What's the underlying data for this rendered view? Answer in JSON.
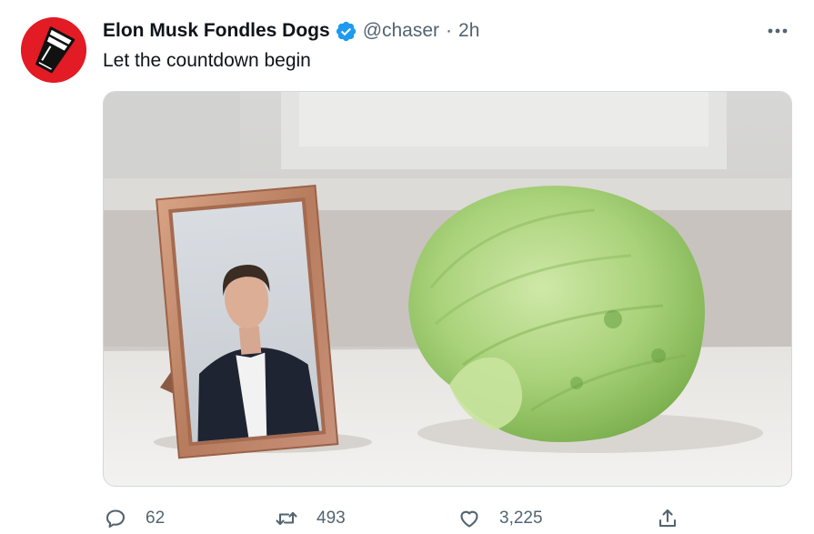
{
  "tweet": {
    "display_name": "Elon Musk Fondles Dogs",
    "handle": "@chaser",
    "separator": "·",
    "time": "2h",
    "text": "Let the countdown begin",
    "verified": true,
    "avatar_icon": "cup-icon",
    "media_alt": "Framed photo of a man in a suit next to a head of iceberg lettuce"
  },
  "actions": {
    "reply_count": "62",
    "retweet_count": "493",
    "like_count": "3,225",
    "share_label": ""
  },
  "icons": {
    "reply": "speech-bubble-icon",
    "retweet": "retweet-arrows-icon",
    "like": "heart-icon",
    "share": "share-upload-icon",
    "more": "more-dots-icon",
    "verified": "verified-badge-icon"
  },
  "colors": {
    "avatar_red": "#e21b24",
    "verified_blue": "#1d9bf0",
    "secondary_text": "#536471",
    "primary_text": "#0f1419"
  }
}
